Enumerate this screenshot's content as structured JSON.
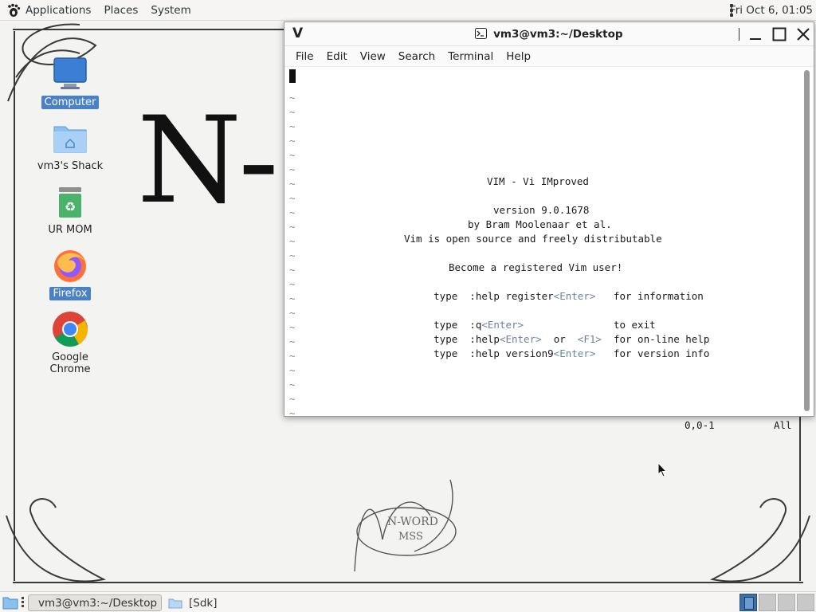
{
  "top_panel": {
    "menus": [
      "Applications",
      "Places",
      "System"
    ],
    "clock": "Fri Oct  6, 01:05"
  },
  "wallpaper": {
    "big_text": "N-"
  },
  "desktop_icons": [
    {
      "label": "Computer",
      "icon": "computer-icon",
      "selected": true
    },
    {
      "label": "vm3's Shack",
      "icon": "home-folder-icon",
      "selected": false
    },
    {
      "label": "UR MOM",
      "icon": "trash-icon",
      "selected": false
    },
    {
      "label": "Firefox",
      "icon": "firefox-icon",
      "selected": true
    },
    {
      "label": "Google Chrome",
      "icon": "chrome-icon",
      "selected": false
    }
  ],
  "terminal": {
    "glyph": "V",
    "title": "vm3@vm3:~/Desktop",
    "menu": [
      "File",
      "Edit",
      "View",
      "Search",
      "Terminal",
      "Help"
    ],
    "vim": {
      "title": "VIM - Vi IMproved",
      "version": "version 9.0.1678",
      "author": "by Bram Moolenaar et al.",
      "license": "Vim is open source and freely distributable",
      "register": "Become a registered Vim user!",
      "l1a": "type  :help register",
      "l1k": "<Enter>",
      "l1b": "   for information",
      "l2a": "type  :q",
      "l2k": "<Enter>",
      "l2b": "               to exit",
      "l3a": "type  :help",
      "l3k1": "<Enter>",
      "l3or": "  or  ",
      "l3k2": "<F1>",
      "l3b": "  for on-line help",
      "l4a": "type  :help version9",
      "l4k": "<Enter>",
      "l4b": "   for version info",
      "position": "0,0-1",
      "scroll": "All",
      "tilde": "~"
    }
  },
  "taskbar": {
    "tasks": [
      {
        "label": "vm3@vm3:~/Desktop",
        "active": true
      },
      {
        "label": "[Sdk]",
        "active": false
      }
    ],
    "workspaces": 4,
    "active_workspace": 1
  },
  "colors": {
    "selection": "#4a80c6",
    "vim_key": "#6b82a8",
    "panel": "#f6f5f4"
  }
}
